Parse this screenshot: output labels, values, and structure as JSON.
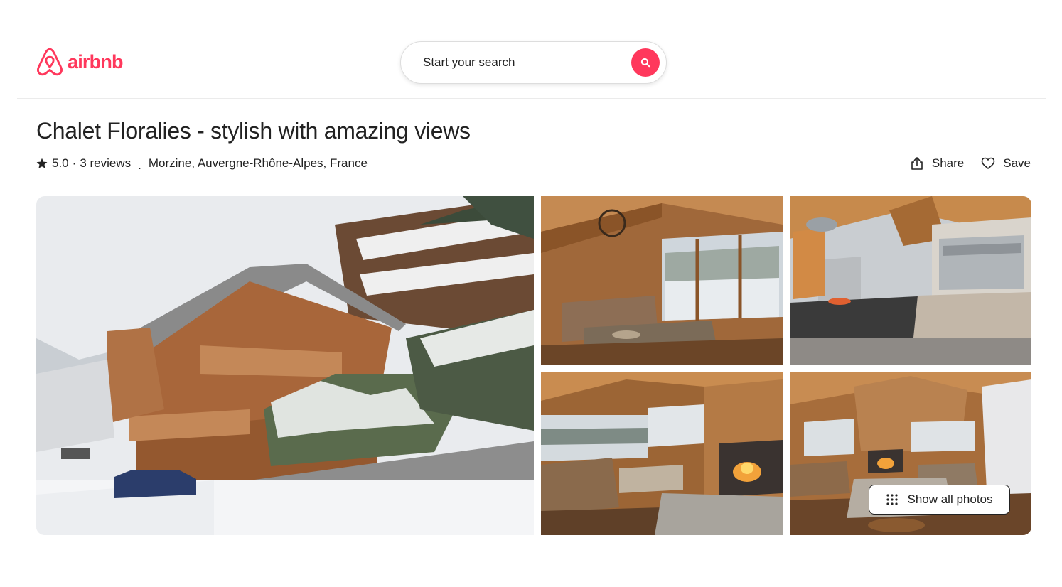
{
  "brand": {
    "name": "airbnb",
    "color": "#ff385c"
  },
  "search": {
    "placeholder": "Start your search",
    "icon": "search-icon"
  },
  "listing": {
    "title": "Chalet Floralies - stylish with amazing views",
    "rating": "5.0",
    "rating_separator": "·",
    "reviews_label": "3 reviews",
    "location_separator": ".",
    "location": "Morzine, Auvergne-Rhône-Alpes, France"
  },
  "actions": {
    "share_label": "Share",
    "save_label": "Save"
  },
  "gallery": {
    "show_all_label": "Show all photos",
    "photos": [
      {
        "subject": "snowy wooden chalet exterior"
      },
      {
        "subject": "living room with mountain view"
      },
      {
        "subject": "kitchen with wooden beams"
      },
      {
        "subject": "lounge with central fireplace"
      },
      {
        "subject": "open living area with fireplace"
      }
    ]
  }
}
